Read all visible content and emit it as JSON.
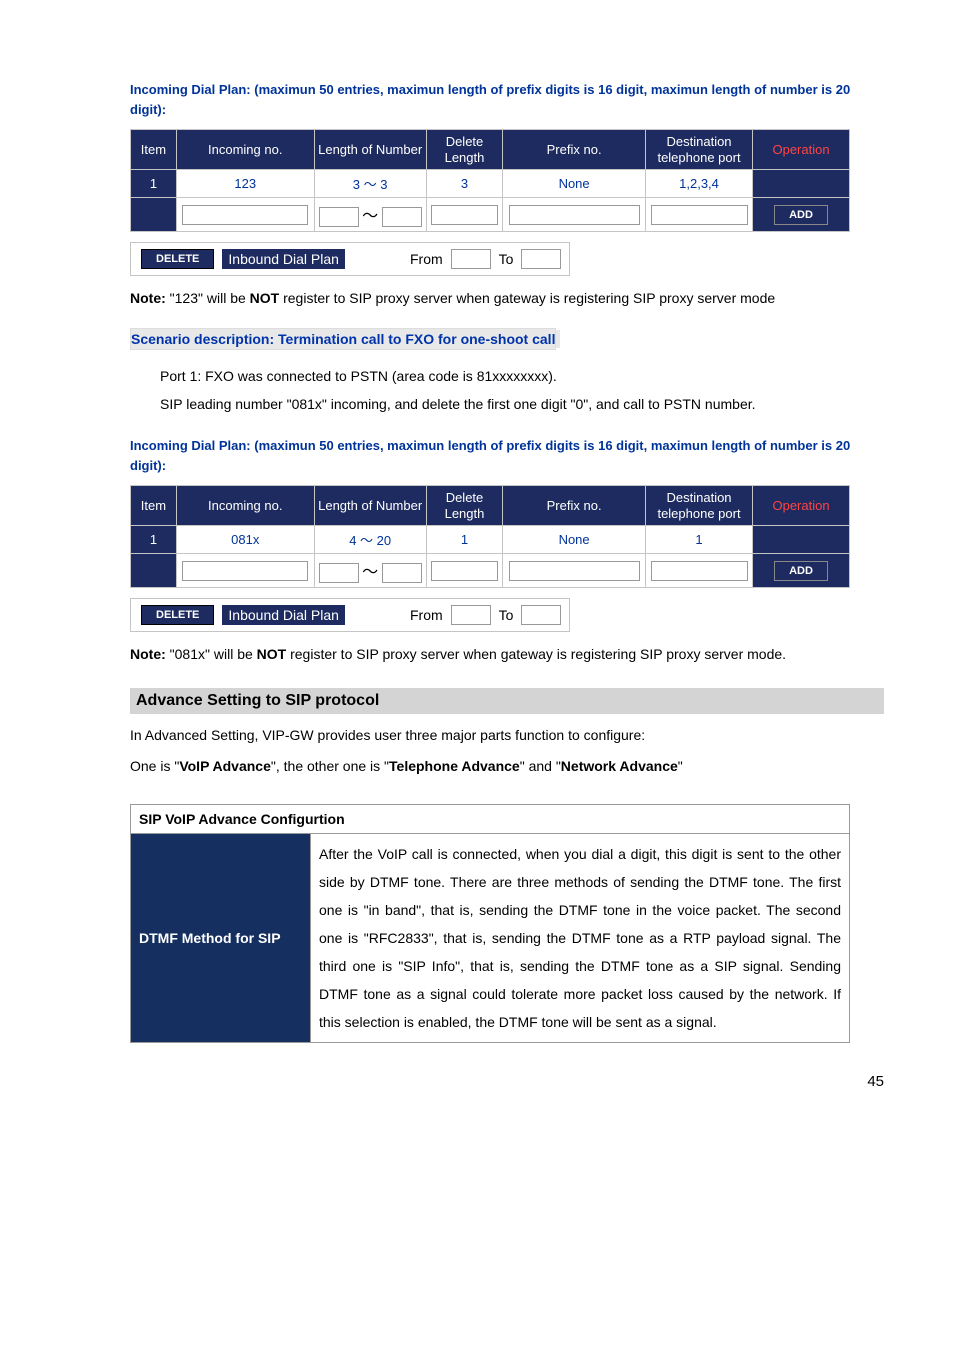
{
  "dialplan": {
    "title": "Incoming Dial Plan: (maximun 50 entries, maximun length of prefix digits is 16 digit, maximun length of number is 20 digit):",
    "headers": {
      "item": "Item",
      "incoming": "Incoming no.",
      "length": "Length of Number",
      "delete": "Delete Length",
      "prefix": "Prefix no.",
      "dest": "Destination telephone port",
      "op": "Operation"
    },
    "tilde": "～",
    "add": "ADD",
    "delete_btn": "DELETE",
    "inbound_label": "Inbound Dial Plan",
    "from": "From",
    "to": "To"
  },
  "table1_row": {
    "item": "1",
    "incoming": "123",
    "length": "3 ～ 3",
    "delete": "3",
    "prefix": "None",
    "dest": "1,2,3,4"
  },
  "note1": {
    "label": "Note:",
    "pre": " \"123\" will be ",
    "not": "NOT",
    "post": " register to SIP proxy server when gateway is registering SIP proxy server mode"
  },
  "scenario": {
    "title": "Scenario description: Termination call to FXO for one-shoot call",
    "line1": "Port 1: FXO was connected to PSTN (area code is 81xxxxxxxx).",
    "line2": "SIP leading number \"081x\" incoming, and delete the first one digit \"0\", and call to PSTN number."
  },
  "table2_row": {
    "item": "1",
    "incoming": "081x",
    "length": "4 ～ 20",
    "delete": "1",
    "prefix": "None",
    "dest": "1"
  },
  "note2": {
    "label": "Note:",
    "pre": " \"081x\" will be ",
    "not": "NOT",
    "post": " register to SIP proxy server when gateway is registering SIP proxy server mode."
  },
  "advance": {
    "heading": "Advance Setting to SIP protocol",
    "para1_pre": "In Advanced Setting, VIP-GW provides user three major parts function to configure:",
    "para2_pre": "One is \"",
    "voip": "VoIP Advance",
    "para2_mid": "\", the other one is \"",
    "tel": "Telephone Advance",
    "para2_mid2": "\" and \"",
    "net": "Network Advance",
    "para2_post": "\""
  },
  "config": {
    "header": "SIP VoIP Advance Configurtion",
    "row1_label": "DTMF Method for SIP",
    "row1_text": "After the VoIP call is connected, when you dial a digit, this digit is sent to the other side by DTMF tone. There are three methods of sending the DTMF tone. The first one is \"in band\", that is, sending the DTMF tone in the voice packet. The second one is \"RFC2833\", that is, sending the DTMF tone as a RTP payload signal. The third one is \"SIP Info\", that is, sending the DTMF tone as a SIP signal. Sending DTMF tone as a signal could tolerate more packet loss caused by the network. If this selection is enabled, the DTMF tone will be sent as a signal."
  },
  "page_number": "45"
}
